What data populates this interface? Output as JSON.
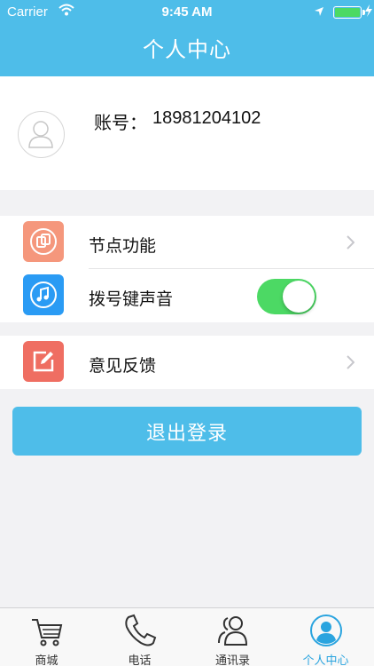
{
  "status_bar": {
    "carrier": "Carrier",
    "time": "9:45 AM"
  },
  "header": {
    "title": "个人中心"
  },
  "profile": {
    "account_label": "账号：",
    "account_value": "18981204102"
  },
  "settings": {
    "items": [
      {
        "label": "节点功能",
        "icon": "node-function-icon",
        "color": "#f5977c"
      },
      {
        "label": "拨号键声音",
        "icon": "music-note-icon",
        "color": "#2a9bf4",
        "toggle_on": true
      },
      {
        "label": "意见反馈",
        "icon": "feedback-edit-icon",
        "color": "#ef6e62"
      }
    ]
  },
  "logout": {
    "label": "退出登录"
  },
  "tabbar": {
    "tabs": [
      {
        "label": "商城",
        "icon": "cart-icon"
      },
      {
        "label": "电话",
        "icon": "phone-icon"
      },
      {
        "label": "通讯录",
        "icon": "contacts-icon"
      },
      {
        "label": "个人中心",
        "icon": "profile-icon",
        "active": true
      }
    ]
  },
  "colors": {
    "accent": "#4ebde9",
    "toggle": "#4cd964",
    "active_tab": "#2aa4df",
    "background": "#f2f2f4"
  }
}
